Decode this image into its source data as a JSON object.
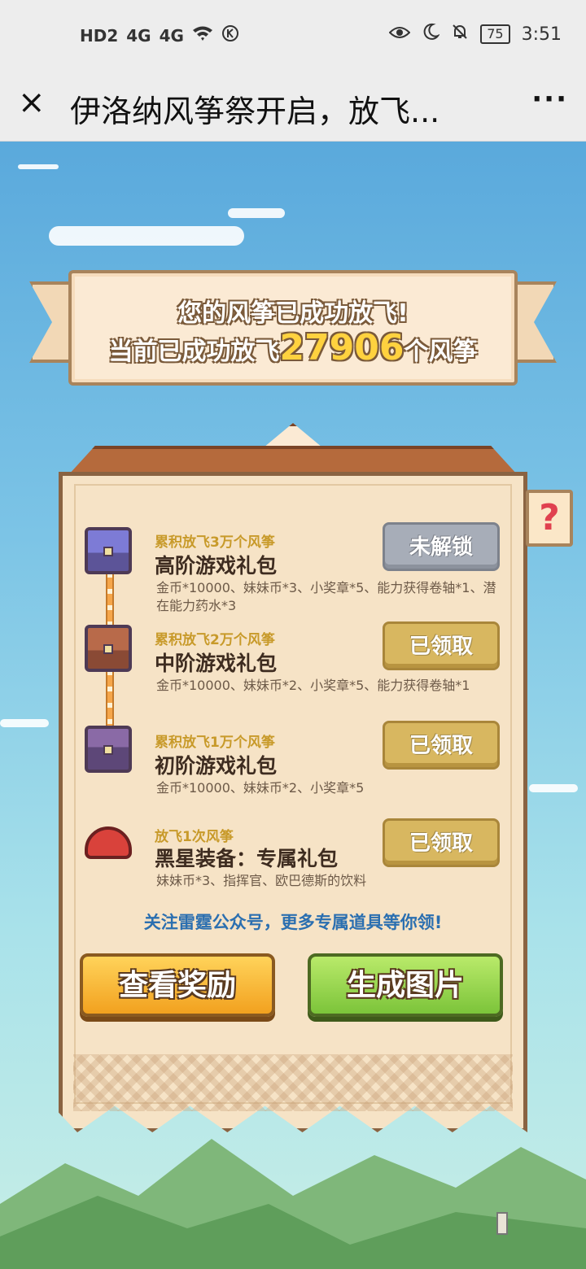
{
  "status_bar": {
    "left": [
      "HD2",
      "4G",
      "4G",
      "wifi-icon",
      "k-icon"
    ],
    "time": "3:51",
    "battery": "75"
  },
  "title_bar": {
    "title": "伊洛纳风筝祭开启，放飞...",
    "close": "×",
    "more": "···"
  },
  "banner": {
    "line1": "您的风筝已成功放飞!",
    "line2_prefix": "当前已成功放飞",
    "count": "27906",
    "line2_suffix": "个风筝"
  },
  "help": "?",
  "rewards": [
    {
      "requirement": "累积放飞3万个风筝",
      "name": "高阶游戏礼包",
      "desc": "金币*10000、妹妹币*3、小奖章*5、能力获得卷轴*1、潜在能力药水*3",
      "status": "未解锁",
      "icon": "chest-high-icon"
    },
    {
      "requirement": "累积放飞2万个风筝",
      "name": "中阶游戏礼包",
      "desc": "金币*10000、妹妹币*2、小奖章*5、能力获得卷轴*1",
      "status": "已领取",
      "icon": "chest-mid-icon"
    },
    {
      "requirement": "累积放飞1万个风筝",
      "name": "初阶游戏礼包",
      "desc": "金币*10000、妹妹币*2、小奖章*5",
      "status": "已领取",
      "icon": "chest-basic-icon"
    },
    {
      "requirement": "放飞1次风筝",
      "name": "黑星装备：专属礼包",
      "desc": "妹妹币*3、指挥官、欧巴德斯的饮料",
      "status": "已领取",
      "icon": "officer-cap-icon"
    }
  ],
  "follow_note": "关注雷霆公众号，更多专属道具等你领!",
  "buttons": {
    "view": "查看奖励",
    "generate": "生成图片"
  }
}
